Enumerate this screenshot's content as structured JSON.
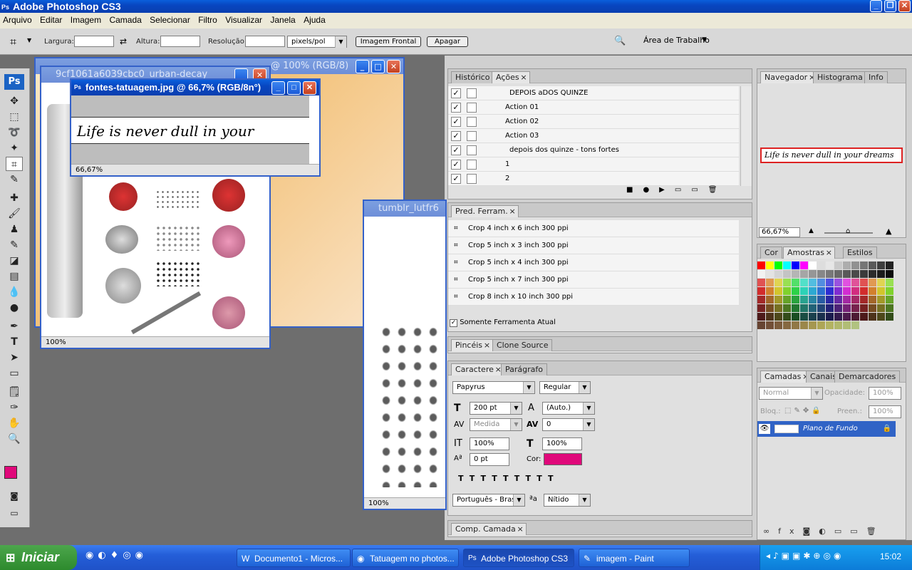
{
  "app": {
    "title": "Adobe Photoshop CS3",
    "logo": "Ps"
  },
  "menu": [
    "Arquivo",
    "Editar",
    "Imagem",
    "Camada",
    "Selecionar",
    "Filtro",
    "Visualizar",
    "Janela",
    "Ajuda"
  ],
  "options": {
    "largura_label": "Largura:",
    "altura_label": "Altura:",
    "resolucao_label": "Resolução:",
    "units": "pixels/pol",
    "front_button": "Imagem Frontal",
    "clear_button": "Apagar",
    "workspace": "Área de Trabalho"
  },
  "documents": {
    "urban": {
      "title": "9cf1061a6039cbc0_urban-decay",
      "suffix": "@ 100% (RGB/8)",
      "zoom": "100%"
    },
    "fontes": {
      "title": "fontes-tatuagem.jpg @ 66,7% (RGB/8n°)",
      "zoom": "66,67%",
      "text": "Life is never dull in your dreams"
    },
    "tumblr": {
      "title": "tumblr_lutfr6",
      "zoom": "100%"
    }
  },
  "history_panel": {
    "tabs": [
      "Histórico",
      "Ações"
    ],
    "rows": [
      "DEPOIS aDOS QUINZE",
      "Action 01",
      "Action 02",
      "Action 03",
      "depois dos quinze - tons fortes",
      "1",
      "2"
    ]
  },
  "tool_presets": {
    "tab": "Pred. Ferram.",
    "items": [
      "Crop 4 inch x 6 inch 300 ppi",
      "Crop 5 inch x 3 inch 300 ppi",
      "Crop 5 inch x 4 inch 300 ppi",
      "Crop 5 inch x 7 inch 300 ppi",
      "Crop 8 inch x 10 inch 300 ppi"
    ],
    "only_current": "Somente Ferramenta Atual"
  },
  "brushes_panel": {
    "tabs": [
      "Pincéis",
      "Clone Source"
    ]
  },
  "character_panel": {
    "tabs": [
      "Caractere",
      "Parágrafo"
    ],
    "font": "Papyrus",
    "style": "Regular",
    "size": "200 pt",
    "leading": "(Auto.)",
    "kerning": "Medida",
    "tracking": "0",
    "vscale": "100%",
    "hscale": "100%",
    "baseline": "0 pt",
    "color_label": "Cor:",
    "language": "Português - Brasil",
    "antialias": "Nítido",
    "text_color": "#e0087a"
  },
  "comp_panel": {
    "tab": "Comp. Camada"
  },
  "navigator": {
    "tabs": [
      "Navegador",
      "Histograma",
      "Info"
    ],
    "zoom": "66,67%",
    "preview_text": "Life is never dull in your dreams"
  },
  "swatches_panel": {
    "tabs": [
      "Cor",
      "Amostras",
      "Estilos"
    ]
  },
  "layers_panel": {
    "tabs": [
      "Camadas",
      "Canais",
      "Demarcadores"
    ],
    "blend": "Normal",
    "opacity_label": "Opacidade:",
    "opacity": "100%",
    "lock_label": "Bloq.:",
    "fill_label": "Preen.:",
    "fill": "100%",
    "layer": "Plano de Fundo"
  },
  "colors": {
    "foreground": "#e0087a",
    "background": "#1a1a50"
  },
  "taskbar": {
    "start": "Iniciar",
    "tasks": [
      "Documento1 - Micros...",
      "Tatuagem no photos...",
      "Adobe Photoshop CS3",
      "imagem - Paint"
    ],
    "clock": "15:02"
  }
}
